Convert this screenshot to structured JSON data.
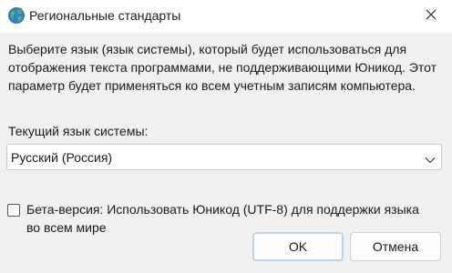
{
  "window": {
    "title": "Региональные стандарты",
    "icon": "globe-icon",
    "close_icon": "close-icon"
  },
  "content": {
    "description": "Выберите язык (язык системы), который будет использоваться для отображения текста программами, не поддерживающими Юникод. Этот параметр будет применяться ко всем учетным записям компьютера.",
    "current_language_label": "Текущий язык системы:",
    "current_language_value": "Русский (Россия)",
    "beta_checkbox_label": "Бета-версия: Использовать Юникод (UTF-8) для поддержки языка во всем мире",
    "beta_checkbox_checked": false
  },
  "buttons": {
    "ok_label": "OK",
    "cancel_label": "Отмена"
  },
  "colors": {
    "accent": "#0067c0",
    "background": "#f0f0f0",
    "titlebar": "#ffffff"
  }
}
